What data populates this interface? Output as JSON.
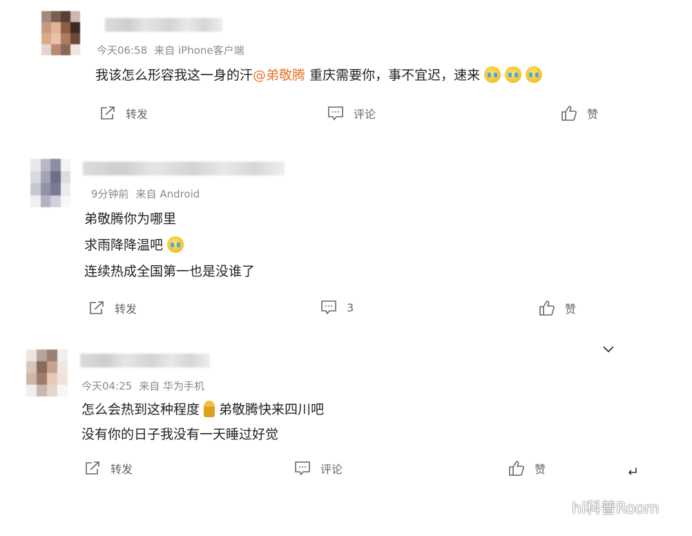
{
  "comments": [
    {
      "meta_time": "今天06:58",
      "meta_source": "来自 iPhone客户端",
      "line1_pre": "我该怎么形容我这一身的汗",
      "line1_mention": "@弟敬腾",
      "line1_post": " 重庆需要你，事不宜迟，速来",
      "repost_label": "转发",
      "comment_label": "评论",
      "like_label": "赞"
    },
    {
      "meta_time": "9分钟前",
      "meta_source": "来自 Android",
      "lines": [
        "弟敬腾你为哪里",
        "求雨降降温吧",
        "连续热成全国第一也是没谁了"
      ],
      "repost_label": "转发",
      "comment_count": "3",
      "like_label": "赞"
    },
    {
      "meta_time": "今天04:25",
      "meta_source": "来自 华为手机",
      "line1_pre": "怎么会热到这种程度",
      "line1_post": "弟敬腾快来四川吧",
      "line2": "没有你的日子我没有一天睡过好觉",
      "repost_label": "转发",
      "comment_label": "评论",
      "like_label": "赞"
    }
  ],
  "watermark": "hi科普Room",
  "icons": {
    "repost": "share-icon",
    "comment": "comment-icon",
    "like": "thumbs-up-icon",
    "expand": "chevron-down-icon",
    "reply": "reply-arrow-icon",
    "wechat": "wechat-icon"
  },
  "colors": {
    "mention": "#e8742f",
    "meta": "#8a8a8a",
    "text": "#222222"
  }
}
